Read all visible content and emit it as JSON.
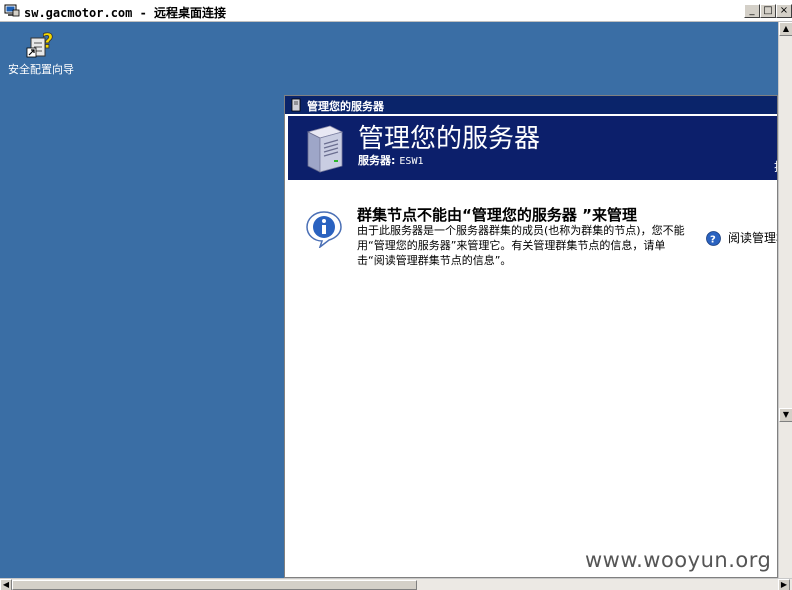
{
  "rdp_window": {
    "title": "sw.gacmotor.com - 远程桌面连接",
    "minimize_glyph": "_",
    "restore_glyph": "□",
    "close_glyph": "×"
  },
  "desktop": {
    "background_color": "#3a6ea5",
    "icons": [
      {
        "label": "安全配置向导",
        "icon": "security-config-wizard-icon"
      }
    ]
  },
  "manage_server": {
    "window_title": "管理您的服务器",
    "banner_title": "管理您的服务器",
    "server_label": "服务器:",
    "server_name": "ESW1",
    "banner_cut_text": "搜",
    "heading": "群集节点不能由“管理您的服务器 ”来管理",
    "body": "由于此服务器是一个服务器群集的成员(也称为群集的节点)，您不能用“管理您的服务器”来管理它。有关管理群集节点的信息，请单击“阅读管理群集节点的信息”。",
    "side_link": "阅读管理群",
    "banner_color": "#0c1f6b",
    "titlebar_color": "#0a246a"
  },
  "watermark": "www.wooyun.org"
}
